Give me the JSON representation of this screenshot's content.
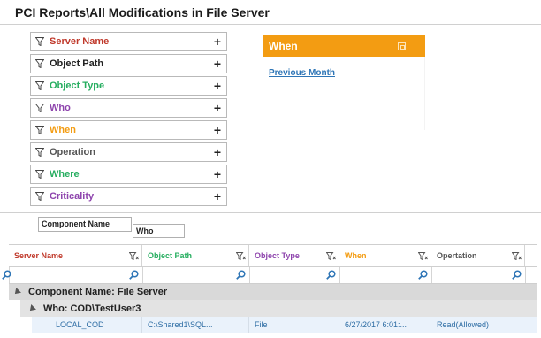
{
  "title": "PCI Reports\\All Modifications in File Server",
  "filters": [
    {
      "label": "Server Name",
      "color": "#c0392b",
      "add": "+"
    },
    {
      "label": "Object Path",
      "color": "#222222",
      "add": "+"
    },
    {
      "label": "Object Type",
      "color": "#27ae60",
      "add": "+"
    },
    {
      "label": "Who",
      "color": "#8e44ad",
      "add": "+"
    },
    {
      "label": "When",
      "color": "#f39c12",
      "add": "+"
    },
    {
      "label": "Operation",
      "color": "#555555",
      "add": "+"
    },
    {
      "label": "Where",
      "color": "#27ae60",
      "add": "+"
    },
    {
      "label": "Criticality",
      "color": "#8e44ad",
      "add": "+"
    }
  ],
  "when_panel": {
    "title": "When",
    "link": "Previous Month",
    "accent": "#f39c12"
  },
  "group_by": {
    "chip1": "Component Name",
    "chip2": "Who"
  },
  "columns": [
    {
      "label": "Server Name",
      "color": "#c0392b"
    },
    {
      "label": "Object Path",
      "color": "#27ae60"
    },
    {
      "label": "Object Type",
      "color": "#8e44ad"
    },
    {
      "label": "When",
      "color": "#f39c12"
    },
    {
      "label": "Opertation",
      "color": "#555555"
    }
  ],
  "groups": {
    "level1": "Component Name: File Server",
    "level2": "Who: COD\\TestUser3"
  },
  "rows": [
    {
      "server_name": "LOCAL_COD",
      "object_path": "C:\\Shared1\\SQL...",
      "object_type": "File",
      "when": "6/27/2017 6:01:...",
      "operation": "Read(Allowed)"
    }
  ]
}
